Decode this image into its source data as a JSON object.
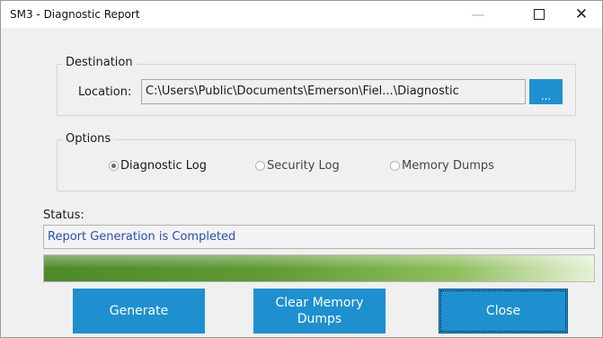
{
  "window": {
    "title": "SM3 - Diagnostic Report",
    "controls": {
      "minimize": "—",
      "close": "✕"
    }
  },
  "destination": {
    "group_label": "Destination",
    "location_label": "Location:",
    "location_value": "C:\\Users\\Public\\Documents\\Emerson\\Fiel...\\Diagnostic",
    "browse_label": "..."
  },
  "options": {
    "group_label": "Options",
    "items": [
      {
        "label": "Diagnostic Log",
        "checked": true
      },
      {
        "label": "Security Log",
        "checked": false
      },
      {
        "label": "Memory Dumps",
        "checked": false
      }
    ]
  },
  "status": {
    "label": "Status:",
    "message": "Report Generation is Completed",
    "progress_fraction": 1.0
  },
  "buttons": {
    "generate": "Generate",
    "clear_memory_dumps": "Clear Memory Dumps",
    "close": "Close"
  },
  "colors": {
    "accent": "#1e90d0",
    "status_text": "#2a4db4",
    "progress": "#5f9a35"
  }
}
